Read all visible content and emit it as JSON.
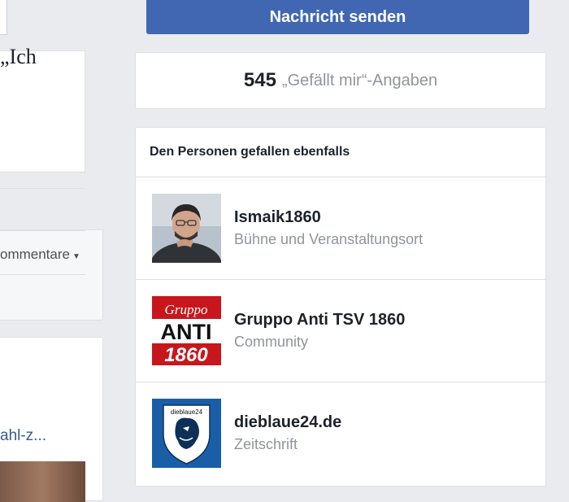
{
  "left": {
    "quote_fragment": "„Ich",
    "comments_label": "ommentare",
    "link_fragment": "ahl-z..."
  },
  "header": {
    "send_button_label": "Nachricht senden"
  },
  "likes": {
    "count": "545",
    "label": "„Gefällt mir“-Angaben"
  },
  "related": {
    "title": "Den Personen gefallen ebenfalls",
    "pages": [
      {
        "name": "Ismaik1860",
        "category": "Bühne und Veranstaltungsort",
        "thumb_icon": "person-photo"
      },
      {
        "name": "Gruppo Anti TSV 1860",
        "category": "Community",
        "thumb_icon": "gruppo-anti-logo",
        "thumb_text_top": "Gruppo",
        "thumb_text_mid": "ANTI",
        "thumb_text_bot": "1860"
      },
      {
        "name": "dieblaue24.de",
        "category": "Zeitschrift",
        "thumb_icon": "lion-shield-logo",
        "thumb_text": "dieblaue24"
      }
    ]
  },
  "colors": {
    "accent": "#4267b2",
    "link": "#385898",
    "muted_text": "#90949c",
    "background": "#e9ebee",
    "gruppo_red": "#c8161d",
    "dieblaue_blue": "#1a5ea8"
  }
}
